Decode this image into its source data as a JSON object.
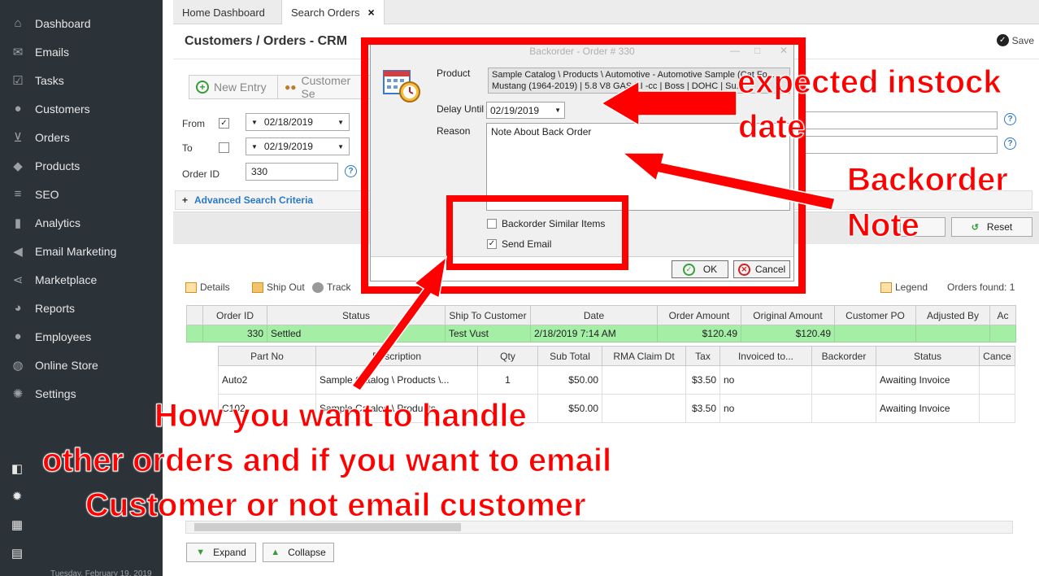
{
  "sidebar": {
    "items": [
      {
        "label": "Dashboard",
        "icon": "home-icon"
      },
      {
        "label": "Emails",
        "icon": "envelope-icon"
      },
      {
        "label": "Tasks",
        "icon": "tasks-icon"
      },
      {
        "label": "Customers",
        "icon": "user-icon"
      },
      {
        "label": "Orders",
        "icon": "cart-icon"
      },
      {
        "label": "Products",
        "icon": "tag-icon"
      },
      {
        "label": "SEO",
        "icon": "sliders-icon"
      },
      {
        "label": "Analytics",
        "icon": "bar-chart-icon"
      },
      {
        "label": "Email Marketing",
        "icon": "megaphone-icon"
      },
      {
        "label": "Marketplace",
        "icon": "share-icon"
      },
      {
        "label": "Reports",
        "icon": "pie-chart-icon"
      },
      {
        "label": "Employees",
        "icon": "people-icon"
      },
      {
        "label": "Online Store",
        "icon": "globe-icon"
      },
      {
        "label": "Settings",
        "icon": "gear-icon"
      }
    ],
    "date_text": "Tuesday, February 19, 2019"
  },
  "tabs": [
    {
      "label": "Home Dashboard"
    },
    {
      "label": "Search Orders",
      "close": "×"
    }
  ],
  "header": {
    "title": "Customers / Orders - CRM",
    "save_label": "Save"
  },
  "subtabs": {
    "new_entry": "New Entry",
    "customer_search": "Customer Se"
  },
  "filters": {
    "from_label": "From",
    "from_checked": "✓",
    "from_date": "02/18/2019",
    "to_label": "To",
    "to_date": "02/19/2019",
    "order_id_label": "Order ID",
    "order_id_value": "330",
    "advanced_label": "Advanced Search Criteria",
    "reset_label": "Reset"
  },
  "toolbar": {
    "details": "Details",
    "ship_out": "Ship Out",
    "track": "Track",
    "legend": "Legend",
    "orders_found": "Orders found: 1"
  },
  "orders_grid": {
    "columns": [
      "Order ID",
      "Status",
      "Ship To Customer",
      "Date",
      "Order Amount",
      "Original Amount",
      "Customer PO",
      "Adjusted By",
      "Ac"
    ],
    "rows": [
      [
        "330",
        "Settled",
        "Test Vust",
        "2/18/2019 7:14 AM",
        "$120.49",
        "$120.49",
        "",
        "",
        ""
      ]
    ]
  },
  "items_grid": {
    "columns": [
      "Part No",
      "Description",
      "Qty",
      "Sub Total",
      "RMA Claim Dt",
      "Tax",
      "Invoiced to...",
      "Backorder",
      "Status",
      "Cance"
    ],
    "rows": [
      [
        "Auto2",
        "Sample Catalog \\ Products \\...",
        "1",
        "$50.00",
        "",
        "$3.50",
        "no",
        "",
        "Awaiting Invoice",
        ""
      ],
      [
        "C102",
        "Sample Catalog \\ Products",
        "",
        "$50.00",
        "",
        "$3.50",
        "no",
        "",
        "Awaiting Invoice",
        ""
      ]
    ]
  },
  "bottom_buttons": {
    "expand": "Expand",
    "collapse": "Collapse"
  },
  "dialog": {
    "title": "Backorder - Order # 330",
    "product_label": "Product",
    "product_line1": "Sample Catalog \\ Products \\ Automotive - Automotive Sample (Cat Fo...",
    "product_line2": "Mustang (1964-2019) | 5.8 V8 GAS EI -cc | Boss | DOHC | Su...",
    "delay_label": "Delay Until",
    "delay_date": "02/19/2019",
    "reason_label": "Reason",
    "reason_text": "Note About Back Order",
    "similar_label": "Backorder Similar Items",
    "send_email_label": "Send Email",
    "send_email_checked": "✓",
    "ok_label": "OK",
    "cancel_label": "Cancel"
  },
  "annotations": {
    "instock_line1": "expected instock",
    "instock_line2": "date",
    "note_line1": "Backorder",
    "note_line2": "Note",
    "handle_line1": "How you want to handle",
    "handle_line2": "other orders and if you want to email",
    "handle_line3": "Customer or not email customer",
    "color": "#ff0000"
  }
}
